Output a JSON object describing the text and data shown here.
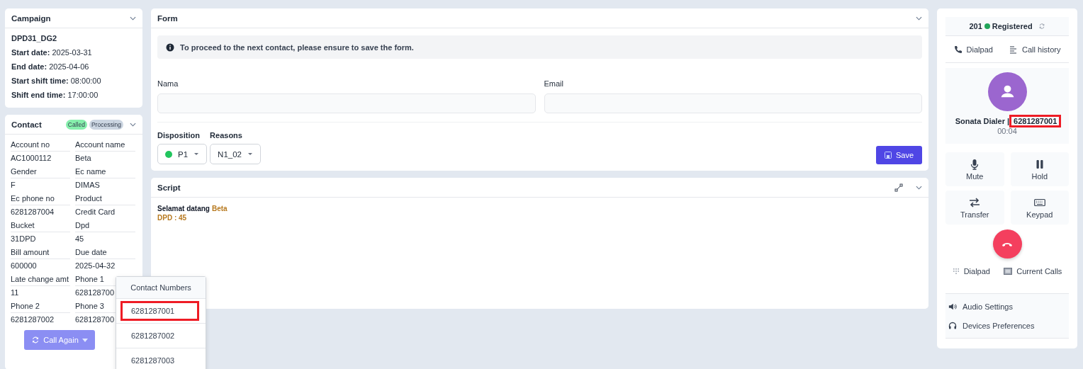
{
  "campaign": {
    "title": "Campaign",
    "name": "DPD31_DG2",
    "fields": [
      {
        "label": "Start date:",
        "value": "2025-03-31"
      },
      {
        "label": "End date:",
        "value": "2025-04-06"
      },
      {
        "label": "Start shift time:",
        "value": "08:00:00"
      },
      {
        "label": "Shift end time:",
        "value": "17:00:00"
      }
    ]
  },
  "contact": {
    "title": "Contact",
    "badges": [
      {
        "label": "Called",
        "color": "#86efac"
      },
      {
        "label": "Processing",
        "color": "#cbd5e1"
      }
    ],
    "fields": [
      {
        "label": "Account no",
        "value": "AC1000112"
      },
      {
        "label": "Account name",
        "value": "Beta"
      },
      {
        "label": "Gender",
        "value": "F"
      },
      {
        "label": "Ec name",
        "value": "DIMAS"
      },
      {
        "label": "Ec phone no",
        "value": "6281287004"
      },
      {
        "label": "Product",
        "value": "Credit Card"
      },
      {
        "label": "Bucket",
        "value": "31DPD"
      },
      {
        "label": "Dpd",
        "value": "45"
      },
      {
        "label": "Bill amount",
        "value": "600000"
      },
      {
        "label": "Due date",
        "value": "2025-04-32"
      },
      {
        "label": "Late change amt",
        "value": "11"
      },
      {
        "label": "Phone 1",
        "value": "628128700"
      },
      {
        "label": "Phone 2",
        "value": "6281287002"
      },
      {
        "label": "Phone 3",
        "value": "628128700"
      }
    ],
    "call_again_button": "Call Again"
  },
  "contact_numbers": {
    "title": "Contact Numbers",
    "items": [
      {
        "number": "6281287001",
        "highlighted": true
      },
      {
        "number": "6281287002",
        "highlighted": false
      },
      {
        "number": "6281287003",
        "highlighted": false
      }
    ]
  },
  "form": {
    "title": "Form",
    "notice": "To proceed to the next contact, please ensure to save the form.",
    "fields": [
      {
        "label": "Nama"
      },
      {
        "label": "Email"
      }
    ],
    "disposition": {
      "label": "Disposition",
      "value": "P1",
      "color": "#22c55e"
    },
    "reasons": {
      "label": "Reasons",
      "value": "N1_02"
    },
    "save_button": "Save"
  },
  "script": {
    "title": "Script",
    "lines": [
      [
        {
          "text": "Selamat datang",
          "kind": "plain"
        },
        {
          "text": "Beta",
          "kind": "accent"
        }
      ],
      [
        {
          "text": "DPD : 45",
          "kind": "accent"
        }
      ]
    ]
  },
  "phone": {
    "extension": "201",
    "status": "Registered",
    "registered": true,
    "tabs": [
      {
        "label": "Dialpad",
        "kind": "dialpad"
      },
      {
        "label": "Call history",
        "kind": "history"
      }
    ],
    "caller": {
      "name": "Sonata Dialer",
      "separator": "|",
      "number": "6281287001",
      "number_highlighted": true,
      "duration": "00:04"
    },
    "actions": [
      {
        "label": "Mute",
        "kind": "mute"
      },
      {
        "label": "Hold",
        "kind": "hold"
      },
      {
        "label": "Transfer",
        "kind": "transfer"
      },
      {
        "label": "Keypad",
        "kind": "keypad"
      }
    ],
    "bottom_tabs": [
      {
        "label": "Dialpad",
        "kind": "dots"
      },
      {
        "label": "Current Calls",
        "kind": "calls"
      }
    ],
    "settings": [
      {
        "label": "Audio Settings",
        "kind": "audio"
      },
      {
        "label": "Devices Preferences",
        "kind": "headset"
      }
    ]
  }
}
